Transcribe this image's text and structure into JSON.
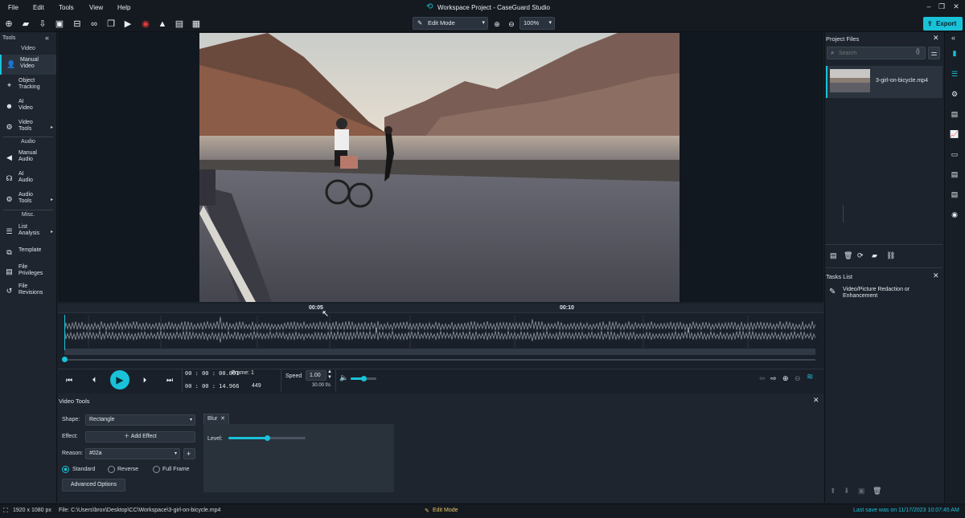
{
  "window": {
    "title": "Workspace Project - CaseGuard Studio",
    "controls": [
      "–",
      "❐",
      "✕"
    ]
  },
  "menu": [
    "File",
    "Edit",
    "Tools",
    "View",
    "Help"
  ],
  "toolbar": {
    "icons": [
      "new-file-icon",
      "open-folder-icon",
      "import-icon",
      "save-icon",
      "archive-icon",
      "binoculars-icon",
      "youtube-icon",
      "record-icon",
      "warning-icon",
      "report-icon",
      "calendar-icon"
    ],
    "mode": "Edit Mode",
    "zoom": "100%",
    "export": "Export"
  },
  "left_panel": {
    "title": "Tools",
    "sections": {
      "video": "Video",
      "audio": "Audio",
      "misc": "Misc."
    },
    "items": {
      "manual_video": "Manual\nVideo",
      "object_tracking": "Object\nTracking",
      "ai_video": "AI\nVideo",
      "video_tools": "Video\nTools",
      "manual_audio": "Manual\nAudio",
      "ai_audio": "AI\nAudio",
      "audio_tools": "Audio\nTools",
      "list_analysis": "List\nAnalysis",
      "template": "Template",
      "file_privileges": "File\nPrivileges",
      "file_revisions": "File\nRevisions"
    }
  },
  "timeline": {
    "marks": [
      "00:05",
      "00:10"
    ]
  },
  "transport": {
    "time_current": "00 : 00 : 00.001",
    "frame_label": "Frame:",
    "frame_current": "1",
    "time_total": "00 : 00 : 14.966",
    "frame_total": "449",
    "speed_label": "Speed",
    "speed": "1.00",
    "fps": "30.00 f/s",
    "volume": 0.5
  },
  "video_tools": {
    "title": "Video Tools",
    "shape_label": "Shape:",
    "shape": "Rectangle",
    "effect_label": "Effect:",
    "add_effect": "Add Effect",
    "reason_label": "Reason:",
    "reason": "#02a",
    "modes": [
      "Standard",
      "Reverse",
      "Full Frame"
    ],
    "selected_mode": "Standard",
    "advanced": "Advanced Options",
    "tab": "Blur",
    "level_label": "Level:",
    "level": 0.5
  },
  "project_files": {
    "title": "Project Files",
    "search_placeholder": "Search",
    "file": "3-girl-on-bicycle.mp4"
  },
  "tasks": {
    "title": "Tasks List",
    "item": "Video/Picture Redaction or Enhancement"
  },
  "status": {
    "resolution": "1920 x 1080 px",
    "file_path": "File: C:\\Users\\brox\\Desktop\\CC\\Workspace\\3-girl-on-bicycle.mp4",
    "mode": "Edit Mode",
    "last_save": "Last save was on 11/17/2023 10:07:45 AM"
  },
  "colors": {
    "accent": "#19c2d8",
    "save_text": "#19c2d8",
    "mode_text": "#e6c766"
  }
}
